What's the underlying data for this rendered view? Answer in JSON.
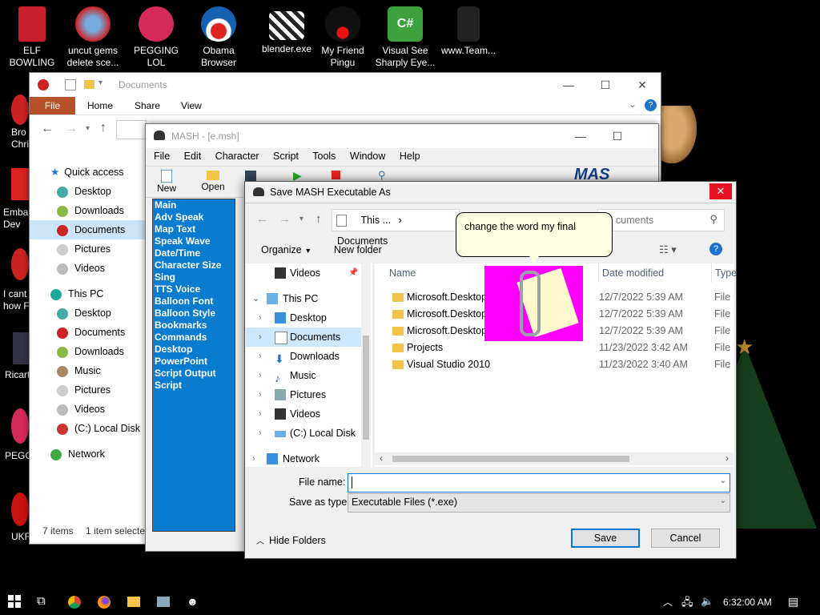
{
  "desktop": {
    "icons": [
      {
        "label": "ELF BOWLING"
      },
      {
        "label": "uncut gems delete sce..."
      },
      {
        "label": "PEGGING LOL"
      },
      {
        "label": "Obama Browser"
      },
      {
        "label": "blender.exe"
      },
      {
        "label": "My Friend Pingu"
      },
      {
        "label": "Visual See Sharply Eye..."
      },
      {
        "label": "www.Team..."
      }
    ],
    "left_edge_labels": [
      "Bro Chri",
      "Emba Dev",
      "I cant how F",
      "Ricart",
      "PEGG",
      "UKF"
    ]
  },
  "explorer": {
    "title": "Documents",
    "ribbon_tabs": [
      "File",
      "Home",
      "Share",
      "View"
    ],
    "quick_access": "Quick access",
    "quick_items": [
      "Desktop",
      "Downloads",
      "Documents",
      "Pictures",
      "Videos"
    ],
    "this_pc": "This PC",
    "pc_items": [
      "Desktop",
      "Documents",
      "Downloads",
      "Music",
      "Pictures",
      "Videos",
      "(C:) Local Disk"
    ],
    "network": "Network",
    "status_items": "7 items",
    "status_selected": "1 item selecte"
  },
  "mash": {
    "title": "MASH - [e.msh]",
    "menu": [
      "File",
      "Edit",
      "Character",
      "Script",
      "Tools",
      "Window",
      "Help"
    ],
    "toolbar": [
      "New",
      "Open"
    ],
    "list": [
      "Main",
      "Adv Speak",
      "Map Text",
      "Speak Wave",
      "Date/Time",
      "Character Size",
      "Sing",
      "TTS Voice",
      "Balloon Font",
      "Balloon Style",
      "Bookmarks",
      "Commands",
      "Desktop",
      "PowerPoint",
      "Script Output",
      "Script"
    ],
    "logo_text": "MAS"
  },
  "dialog": {
    "title": "Save MASH Executable As",
    "breadcrumb": [
      "This ...",
      "Documents"
    ],
    "search_placeholder": "cuments",
    "organize": "Organize",
    "new_folder": "New folder",
    "tree": [
      "Videos",
      "This PC",
      "Desktop",
      "Documents",
      "Downloads",
      "Music",
      "Pictures",
      "Videos",
      "(C:) Local Disk",
      "Network"
    ],
    "columns": [
      "Name",
      "Date modified",
      "Type"
    ],
    "files": [
      {
        "name": "Microsoft.Desktop.",
        "date": "12/7/2022 5:39 AM",
        "type": "File fo"
      },
      {
        "name": "Microsoft.Desktop.",
        "date": "12/7/2022 5:39 AM",
        "type": "File fo"
      },
      {
        "name": "Microsoft.Desktop.",
        "date": "12/7/2022 5:39 AM",
        "type": "File fo"
      },
      {
        "name": "Projects",
        "date": "11/23/2022 3:42 AM",
        "type": "File fo"
      },
      {
        "name": "Visual Studio 2010",
        "date": "11/23/2022 3:40 AM",
        "type": "File fo"
      }
    ],
    "file_name_label": "File name:",
    "file_name_value": "",
    "save_type_label": "Save as type:",
    "save_type_value": "Executable Files (*.exe)",
    "hide_folders": "Hide Folders",
    "save": "Save",
    "cancel": "Cancel"
  },
  "balloon": {
    "text": "change the word my final"
  },
  "taskbar": {
    "time": "6:32:00 AM"
  },
  "colors": {
    "mash_list_bg": "#0a7ccf",
    "accent": "#0078d7",
    "clippy_bg": "#ff00ff",
    "dialog_close": "#e81123",
    "explorer_file_tab": "#b5522a"
  }
}
